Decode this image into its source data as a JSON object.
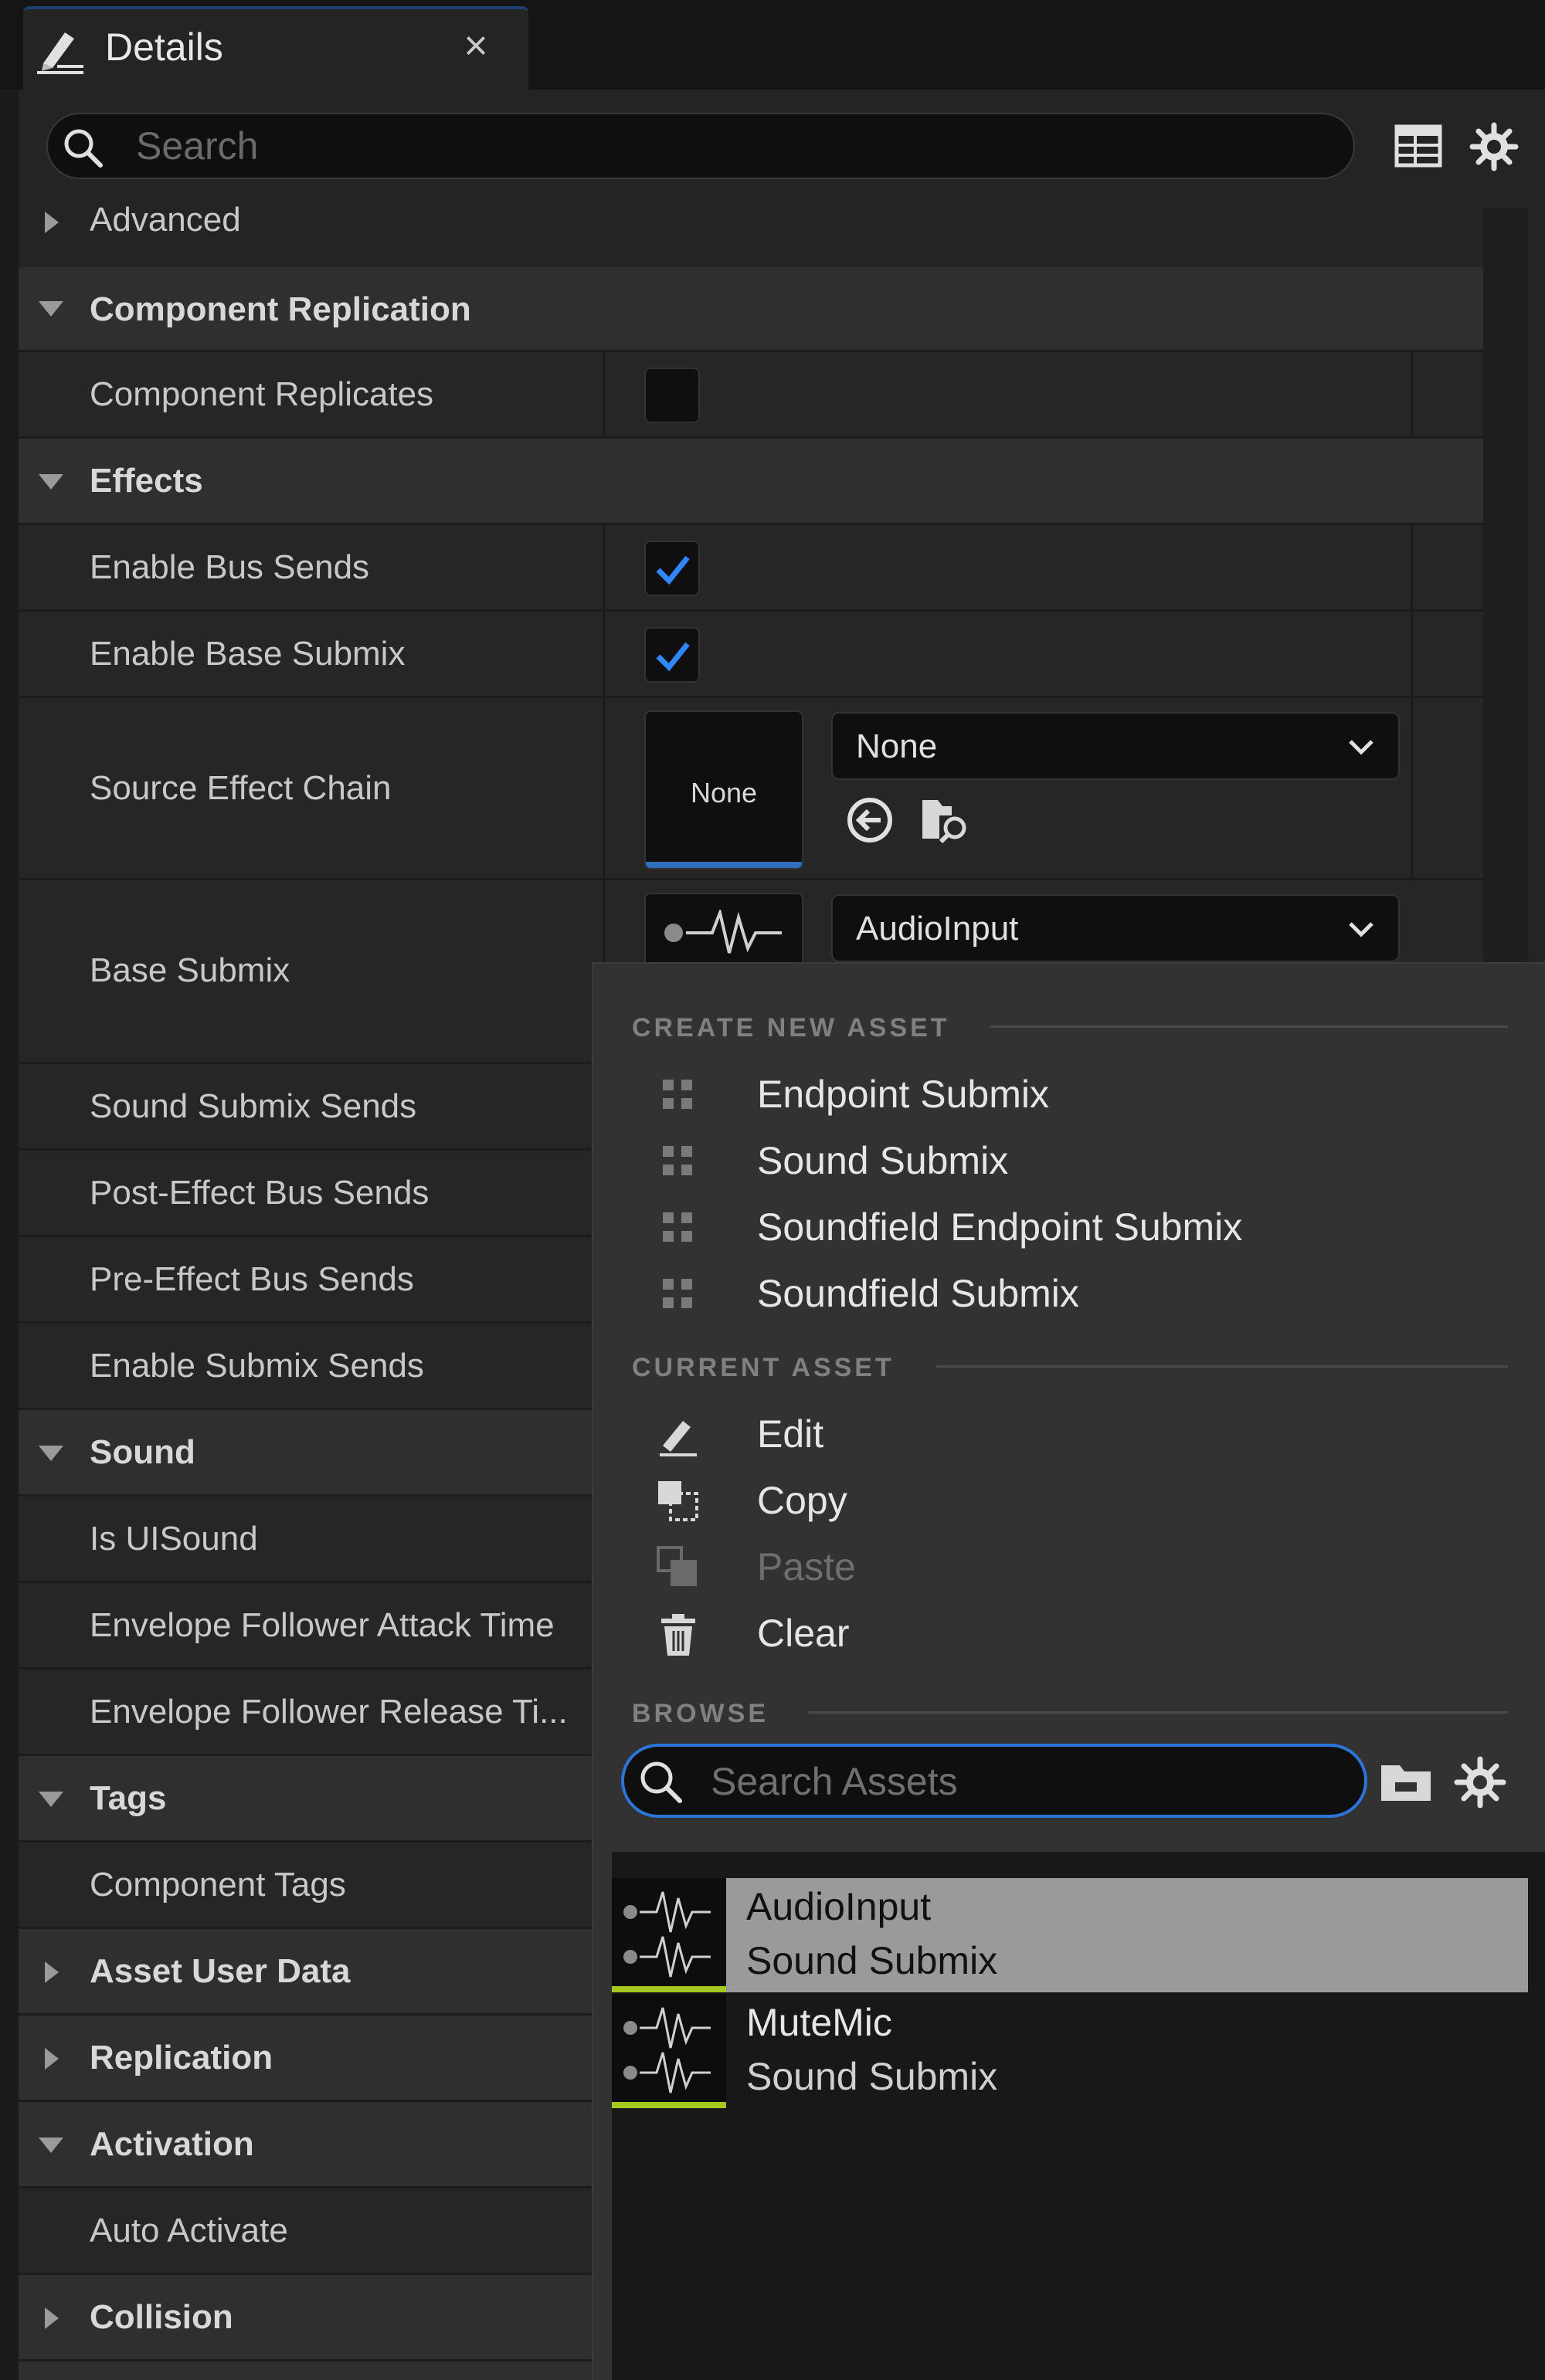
{
  "tab": {
    "title": "Details",
    "close": "×"
  },
  "search": {
    "placeholder": "Search"
  },
  "categories": {
    "advanced": "Advanced",
    "component_replication": "Component Replication",
    "effects": "Effects",
    "sound": "Sound",
    "tags": "Tags",
    "asset_user_data": "Asset User Data",
    "replication": "Replication",
    "activation": "Activation",
    "collision": "Collision"
  },
  "properties": {
    "component_replicates": {
      "label": "Component Replicates",
      "checked": false
    },
    "enable_bus_sends": {
      "label": "Enable Bus Sends",
      "checked": true
    },
    "enable_base_submix": {
      "label": "Enable Base Submix",
      "checked": true
    },
    "source_effect_chain": {
      "label": "Source Effect Chain",
      "thumb": "None",
      "value": "None"
    },
    "base_submix": {
      "label": "Base Submix",
      "value": "AudioInput"
    },
    "sound_submix_sends": "Sound Submix Sends",
    "post_effect_bus_sends": "Post-Effect Bus Sends",
    "pre_effect_bus_sends": "Pre-Effect Bus Sends",
    "enable_submix_sends": "Enable Submix Sends",
    "is_ui_sound": "Is UISound",
    "envelope_attack": "Envelope Follower Attack Time",
    "envelope_release": "Envelope Follower Release Ti...",
    "component_tags": "Component Tags",
    "auto_activate": "Auto Activate"
  },
  "menu": {
    "create_new_asset": "CREATE NEW ASSET",
    "create_items": [
      "Endpoint Submix",
      "Sound Submix",
      "Soundfield Endpoint Submix",
      "Soundfield Submix"
    ],
    "current_asset": "CURRENT ASSET",
    "edit": "Edit",
    "copy": "Copy",
    "paste": "Paste",
    "clear": "Clear",
    "browse": "BROWSE",
    "asset_search_placeholder": "Search Assets",
    "assets": [
      {
        "name": "AudioInput",
        "type": "Sound Submix",
        "selected": true
      },
      {
        "name": "MuteMic",
        "type": "Sound Submix",
        "selected": false
      }
    ]
  },
  "colors": {
    "accent": "#2c74d6",
    "check": "#2f86ff",
    "submix_bar": "#a4c81e",
    "selected_row": "#9a9a9a"
  }
}
